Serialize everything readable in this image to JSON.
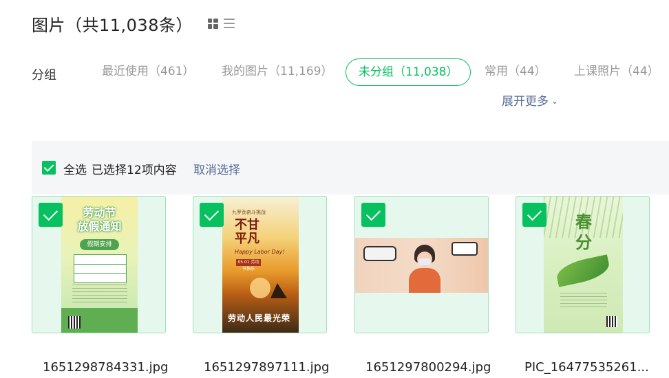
{
  "header": {
    "title": "图片（共11,038条）",
    "view_icons": [
      "grid-view-icon",
      "list-view-icon"
    ]
  },
  "groups": {
    "label": "分组",
    "tabs": [
      {
        "label": "最近使用（461）",
        "active": false
      },
      {
        "label": "我的图片（11,169）",
        "active": false
      },
      {
        "label": "未分组（11,038）",
        "active": true
      },
      {
        "label": "常用（44）",
        "active": false
      },
      {
        "label": "上课照片（44）",
        "active": false
      }
    ],
    "expand_label": "展开更多",
    "expand_icon": "chevron-down-icon"
  },
  "selection": {
    "select_all_label": "全选",
    "selected_text": "已选择12项内容",
    "cancel_label": "取消选择"
  },
  "images": [
    {
      "filename": "1651298784331.jpg",
      "selected": true,
      "thumb_text": {
        "headline": "劳动节\n放假通知",
        "pill": "假期安排"
      }
    },
    {
      "filename": "1651297897111.jpg",
      "selected": true,
      "thumb_text": {
        "top": "九罗劲奋斗挑战",
        "big": "不甘\n平凡",
        "script": "Happy Labor Day!",
        "date": "05.01 劳动节快乐",
        "slogan": "劳动人民最光荣"
      }
    },
    {
      "filename": "1651297800294.jpg",
      "selected": true,
      "thumb_text": {}
    },
    {
      "filename": "PIC_16477535261...",
      "selected": true,
      "thumb_text": {
        "big": "春分"
      }
    }
  ],
  "colors": {
    "accent": "#07c160",
    "link": "#576b95",
    "card_bg": "#e6f8ed",
    "card_border": "#9fdfba",
    "select_bar_bg": "#f5f6f7"
  }
}
